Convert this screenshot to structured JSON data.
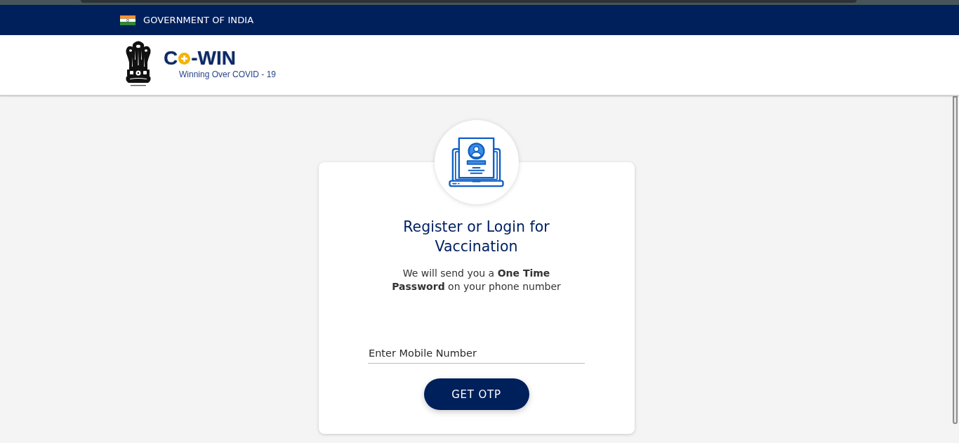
{
  "gov_bar": {
    "title": "GOVERNMENT OF INDIA"
  },
  "header": {
    "logo": {
      "text_start": "C",
      "text_end": "-WIN",
      "tagline": "Winning Over COVID - 19"
    }
  },
  "login_card": {
    "title": "Register or Login for Vaccination",
    "description": "We will send you a **One Time Password** on your phone number",
    "mobile_field": {
      "placeholder": "Enter Mobile Number"
    },
    "button": "GET OTP"
  }
}
